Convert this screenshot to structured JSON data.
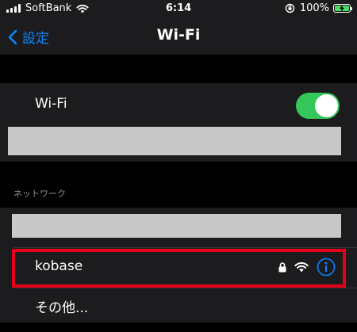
{
  "status_bar": {
    "carrier": "SoftBank",
    "time": "6:14",
    "battery_percent": "100%",
    "battery_charging": true
  },
  "nav": {
    "back_label": "設定",
    "title": "Wi-Fi"
  },
  "wifi_toggle": {
    "label": "Wi-Fi",
    "on": true
  },
  "networks": {
    "section_header": "ネットワーク",
    "items": [
      {
        "name": "kobase",
        "secured": true,
        "highlighted": true
      }
    ],
    "other_label": "その他..."
  },
  "colors": {
    "accent": "#0a84ff",
    "toggle_on": "#34c759",
    "highlight_border": "#e3001b",
    "redaction": "#c8c8c8"
  }
}
